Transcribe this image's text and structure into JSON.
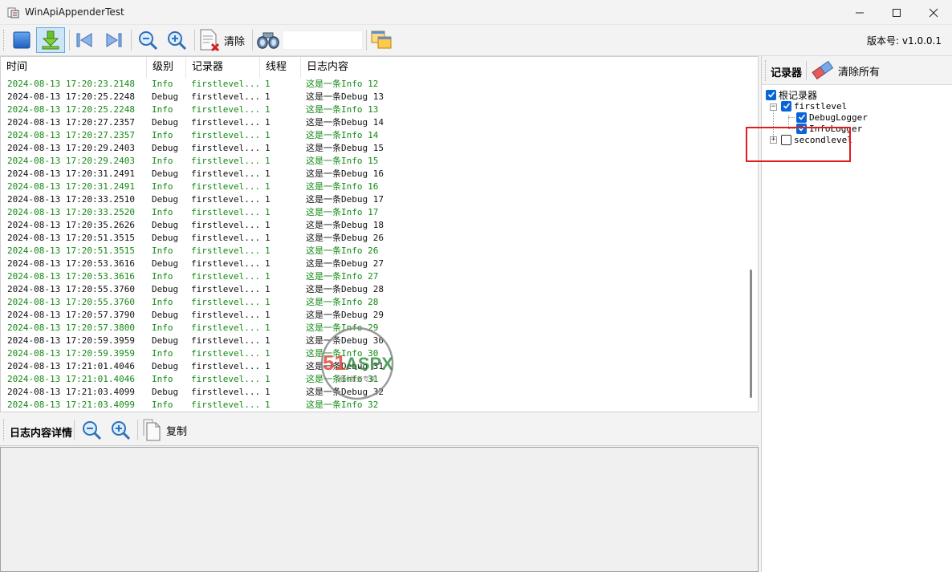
{
  "window": {
    "title": "WinApiAppenderTest",
    "minimize_icon": "minimize-icon",
    "maximize_icon": "maximize-icon",
    "close_icon": "close-icon"
  },
  "toolbar": {
    "clear_label": "清除",
    "version_label": "版本号: v1.0.0.1",
    "find_value": ""
  },
  "grid": {
    "columns": [
      "时间",
      "级别",
      "记录器",
      "线程",
      "日志内容"
    ],
    "rows": [
      {
        "time": "2024-08-13 17:20:23.2148",
        "level": "Info",
        "logger": "firstlevel...",
        "thread": "1",
        "message": "这是一条Info 12"
      },
      {
        "time": "2024-08-13 17:20:25.2248",
        "level": "Debug",
        "logger": "firstlevel...",
        "thread": "1",
        "message": "这是一条Debug 13"
      },
      {
        "time": "2024-08-13 17:20:25.2248",
        "level": "Info",
        "logger": "firstlevel...",
        "thread": "1",
        "message": "这是一条Info 13"
      },
      {
        "time": "2024-08-13 17:20:27.2357",
        "level": "Debug",
        "logger": "firstlevel...",
        "thread": "1",
        "message": "这是一条Debug 14"
      },
      {
        "time": "2024-08-13 17:20:27.2357",
        "level": "Info",
        "logger": "firstlevel...",
        "thread": "1",
        "message": "这是一条Info 14"
      },
      {
        "time": "2024-08-13 17:20:29.2403",
        "level": "Debug",
        "logger": "firstlevel...",
        "thread": "1",
        "message": "这是一条Debug 15"
      },
      {
        "time": "2024-08-13 17:20:29.2403",
        "level": "Info",
        "logger": "firstlevel...",
        "thread": "1",
        "message": "这是一条Info 15"
      },
      {
        "time": "2024-08-13 17:20:31.2491",
        "level": "Debug",
        "logger": "firstlevel...",
        "thread": "1",
        "message": "这是一条Debug 16"
      },
      {
        "time": "2024-08-13 17:20:31.2491",
        "level": "Info",
        "logger": "firstlevel...",
        "thread": "1",
        "message": "这是一条Info 16"
      },
      {
        "time": "2024-08-13 17:20:33.2510",
        "level": "Debug",
        "logger": "firstlevel...",
        "thread": "1",
        "message": "这是一条Debug 17"
      },
      {
        "time": "2024-08-13 17:20:33.2520",
        "level": "Info",
        "logger": "firstlevel...",
        "thread": "1",
        "message": "这是一条Info 17"
      },
      {
        "time": "2024-08-13 17:20:35.2626",
        "level": "Debug",
        "logger": "firstlevel...",
        "thread": "1",
        "message": "这是一条Debug 18"
      },
      {
        "time": "2024-08-13 17:20:51.3515",
        "level": "Debug",
        "logger": "firstlevel...",
        "thread": "1",
        "message": "这是一条Debug 26"
      },
      {
        "time": "2024-08-13 17:20:51.3515",
        "level": "Info",
        "logger": "firstlevel...",
        "thread": "1",
        "message": "这是一条Info 26"
      },
      {
        "time": "2024-08-13 17:20:53.3616",
        "level": "Debug",
        "logger": "firstlevel...",
        "thread": "1",
        "message": "这是一条Debug 27"
      },
      {
        "time": "2024-08-13 17:20:53.3616",
        "level": "Info",
        "logger": "firstlevel...",
        "thread": "1",
        "message": "这是一条Info 27"
      },
      {
        "time": "2024-08-13 17:20:55.3760",
        "level": "Debug",
        "logger": "firstlevel...",
        "thread": "1",
        "message": "这是一条Debug 28"
      },
      {
        "time": "2024-08-13 17:20:55.3760",
        "level": "Info",
        "logger": "firstlevel...",
        "thread": "1",
        "message": "这是一条Info 28"
      },
      {
        "time": "2024-08-13 17:20:57.3790",
        "level": "Debug",
        "logger": "firstlevel...",
        "thread": "1",
        "message": "这是一条Debug 29"
      },
      {
        "time": "2024-08-13 17:20:57.3800",
        "level": "Info",
        "logger": "firstlevel...",
        "thread": "1",
        "message": "这是一条Info 29"
      },
      {
        "time": "2024-08-13 17:20:59.3959",
        "level": "Debug",
        "logger": "firstlevel...",
        "thread": "1",
        "message": "这是一条Debug 30"
      },
      {
        "time": "2024-08-13 17:20:59.3959",
        "level": "Info",
        "logger": "firstlevel...",
        "thread": "1",
        "message": "这是一条Info 30"
      },
      {
        "time": "2024-08-13 17:21:01.4046",
        "level": "Debug",
        "logger": "firstlevel...",
        "thread": "1",
        "message": "这是一条Debug 31"
      },
      {
        "time": "2024-08-13 17:21:01.4046",
        "level": "Info",
        "logger": "firstlevel...",
        "thread": "1",
        "message": "这是一条Info 31"
      },
      {
        "time": "2024-08-13 17:21:03.4099",
        "level": "Debug",
        "logger": "firstlevel...",
        "thread": "1",
        "message": "这是一条Debug 32"
      },
      {
        "time": "2024-08-13 17:21:03.4099",
        "level": "Info",
        "logger": "firstlevel...",
        "thread": "1",
        "message": "这是一条Info 32"
      }
    ]
  },
  "detail": {
    "title": "日志内容详情",
    "copy_label": "复制"
  },
  "loggers_panel": {
    "title": "记录器",
    "clear_all_label": "清除所有",
    "tree": {
      "root": {
        "label": "根记录器",
        "checked": true
      },
      "first": {
        "label": "firstlevel",
        "checked": true
      },
      "debug": {
        "label": "DebugLogger",
        "checked": true
      },
      "info": {
        "label": "InfoLogger",
        "checked": true
      },
      "second": {
        "label": "secondlevel",
        "checked": false
      }
    }
  },
  "watermark": {
    "brand": "51ASPX",
    "tagline": "源码服务专家"
  },
  "colors": {
    "info_row": "#138a13",
    "debug_row": "#111111",
    "checkbox_on": "#0a64d6",
    "highlight": "#e01c1c"
  }
}
